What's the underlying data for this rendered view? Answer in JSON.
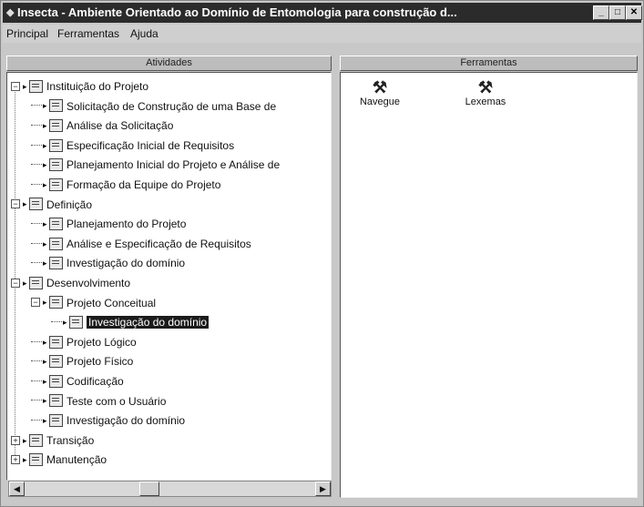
{
  "window": {
    "title": "Insecta - Ambiente Orientado ao Domínio de Entomologia para construção d...",
    "controls": {
      "minimize": "_",
      "maximize": "□",
      "close": "✕"
    }
  },
  "menu": [
    "Principal",
    "Ferramentas",
    "Ajuda"
  ],
  "activities_panel": {
    "header": "Atividades",
    "tree": [
      {
        "label": "Instituição do Projeto",
        "level": 0,
        "expander": "−"
      },
      {
        "label": "Solicitação de Construção de uma Base de",
        "level": 1
      },
      {
        "label": "Análise da Solicitação",
        "level": 1
      },
      {
        "label": "Especificação Inicial de Requisitos",
        "level": 1
      },
      {
        "label": "Planejamento Inicial do Projeto e Análise de",
        "level": 1
      },
      {
        "label": "Formação da Equipe do Projeto",
        "level": 1
      },
      {
        "label": "Definição",
        "level": 0,
        "expander": "−"
      },
      {
        "label": "Planejamento do Projeto",
        "level": 1
      },
      {
        "label": "Análise e Especificação de Requisitos",
        "level": 1
      },
      {
        "label": "Investigação do domínio",
        "level": 1
      },
      {
        "label": "Desenvolvimento",
        "level": 0,
        "expander": "−"
      },
      {
        "label": "Projeto Conceitual",
        "level": 1,
        "expander": "−"
      },
      {
        "label": "Investigação do domínio",
        "level": 2,
        "selected": true
      },
      {
        "label": "Projeto Lógico",
        "level": 1
      },
      {
        "label": "Projeto Físico",
        "level": 1
      },
      {
        "label": "Codificação",
        "level": 1
      },
      {
        "label": "Teste com o Usuário",
        "level": 1
      },
      {
        "label": "Investigação do domínio",
        "level": 1
      },
      {
        "label": "Transição",
        "level": 0,
        "expander": "+"
      },
      {
        "label": "Manutenção",
        "level": 0,
        "expander": "+"
      }
    ]
  },
  "tools_panel": {
    "header": "Ferramentas",
    "tools": [
      {
        "label": "Navegue",
        "icon": "hammer-icon"
      },
      {
        "label": "Lexemas",
        "icon": "hammer-icon"
      }
    ]
  },
  "scrollbar": {
    "left": "◀",
    "right": "▶"
  }
}
